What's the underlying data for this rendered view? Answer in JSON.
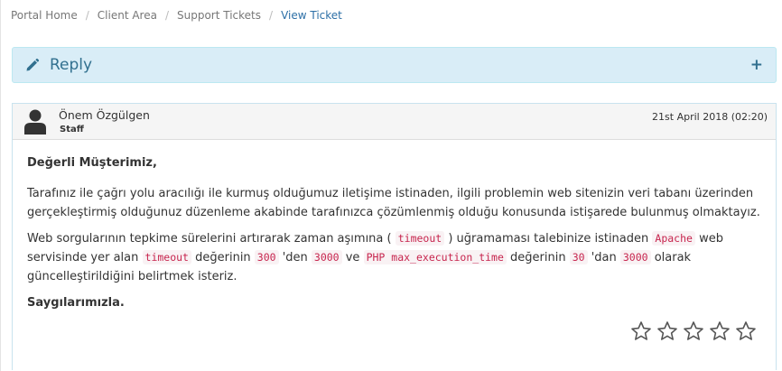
{
  "breadcrumb": {
    "items": [
      "Portal Home",
      "Client Area",
      "Support Tickets",
      "View Ticket"
    ],
    "separator": "/"
  },
  "reply": {
    "label": "Reply",
    "expand_symbol": "+",
    "icon": "pencil-icon",
    "background": "#d9edf7",
    "text_color": "#31708f"
  },
  "message": {
    "author": "Önem Özgülgen",
    "role": "Staff",
    "date": "21st April 2018 (02:20)",
    "avatar_icon": "user-icon",
    "greeting": "Değerli Müşterimiz,",
    "paragraph1": "Tarafınız ile çağrı yolu aracılığı ile kurmuş olduğumuz iletişime istinaden, ilgili problemin web sitenizin veri tabanı üzerinden gerçekleştirmiş olduğunuz düzenleme akabinde tarafınızca çözümlenmiş olduğu konusunda istişarede bulunmuş olmaktayız.",
    "paragraph2": {
      "t1": "Web sorgularının tepkime sürelerini artırarak zaman aşımına ( ",
      "c1": "timeout",
      "t2": " ) uğramaması talebinize istinaden ",
      "c2": "Apache",
      "t3": " web servisinde yer alan ",
      "c3": "timeout",
      "t4": " değerinin ",
      "c4": "300",
      "t5": " 'den ",
      "c5": "3000",
      "t6": " ve ",
      "c6": "PHP max_execution_time",
      "t7": " değerinin ",
      "c7": "30",
      "t8": " 'dan ",
      "c8": "3000",
      "t9": " olarak güncelleştirildiğini belirtmek isteriz."
    },
    "signoff": "Saygılarımızla."
  },
  "rating": {
    "stars": 5,
    "selected": 0,
    "icon": "star-outline-icon"
  }
}
